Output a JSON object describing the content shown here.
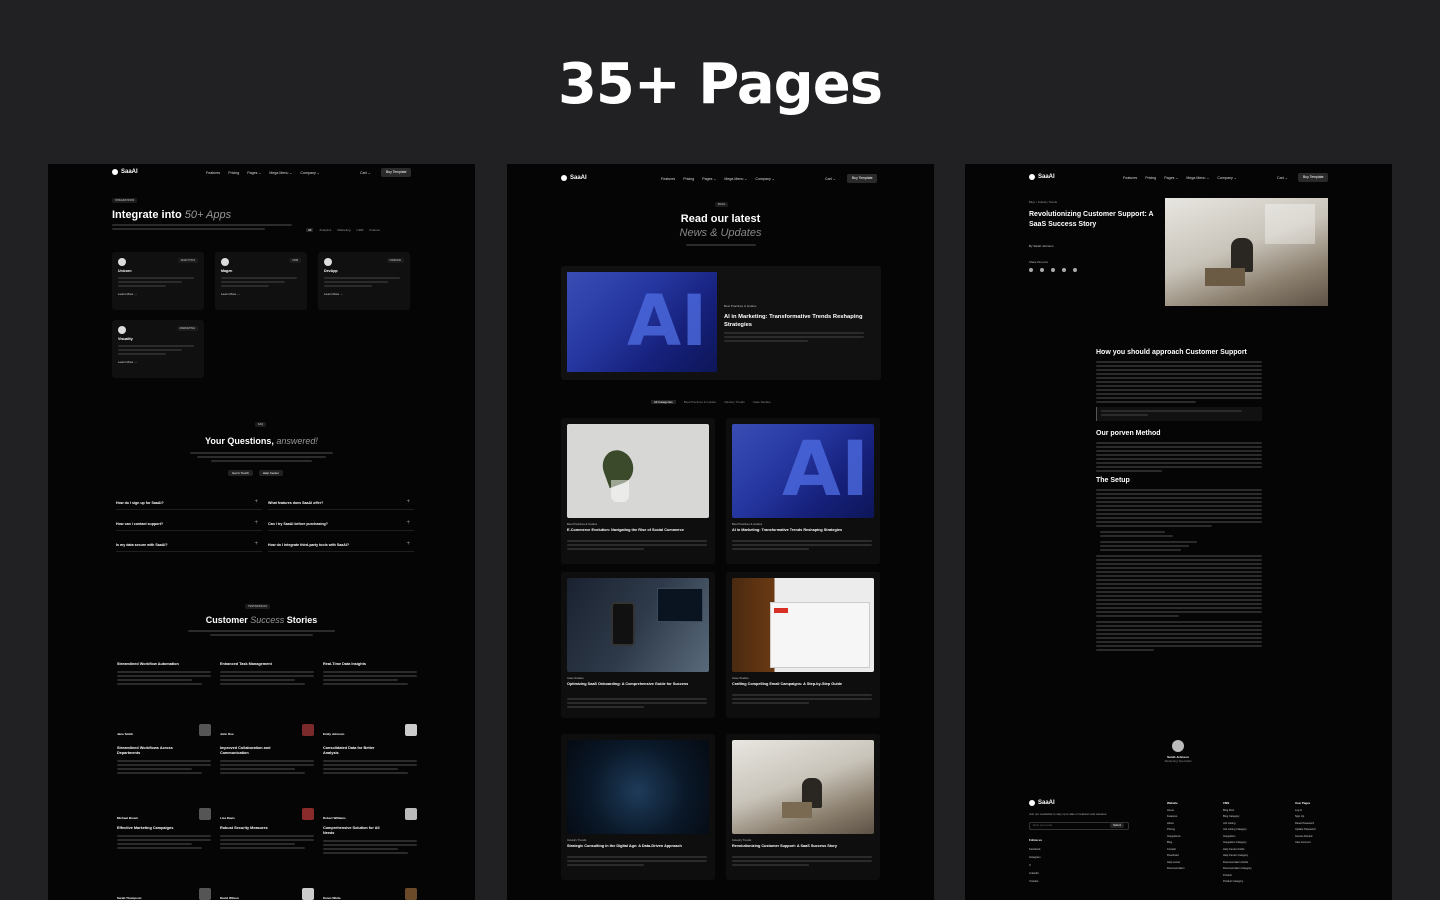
{
  "hero": {
    "title": "35+ Pages"
  },
  "nav": {
    "logo": "SaaAI",
    "links": [
      "Features",
      "Pricing",
      "Pages ⌄",
      "Mega Menu ⌄",
      "Company ⌄"
    ],
    "cart": "Cart ⌄",
    "buy": "Buy Template"
  },
  "integrations": {
    "tag": "INTEGRATIONS",
    "title_main": "Integrate into",
    "title_accent": "50+ Apps",
    "filters": [
      "All",
      "Analytics",
      "Marketing",
      "CRM",
      "Finance"
    ],
    "cards": [
      {
        "name": "Unicorn",
        "badge": "ANALYTICS",
        "link": "Learn More →"
      },
      {
        "name": "Magen",
        "badge": "CRM",
        "link": "Learn More →"
      },
      {
        "name": "DevApp",
        "badge": "FINANCE",
        "link": "Learn More →"
      },
      {
        "name": "Visuality",
        "badge": "MARKETING",
        "link": "Learn More →"
      }
    ]
  },
  "faq": {
    "tag": "FAQ",
    "title_main": "Your Questions,",
    "title_accent": "answered!",
    "buttons": [
      "Get in Touch",
      "Help Center"
    ],
    "questions": [
      "How do I sign up for SaaAI?",
      "How can I contact support?",
      "Is my data secure with SaaAI?",
      "What features does SaaAI offer?",
      "Can I try SaaAI before purchasing?",
      "How do I integrate third-party tools with SaaAI?"
    ]
  },
  "testimonials": {
    "tag": "TESTIMONIALS",
    "title_main": "Customer",
    "title_accent": "Success",
    "title_end": "Stories",
    "cards": [
      {
        "title": "Streamlined Workflow Automation",
        "name": "Jane Smith"
      },
      {
        "title": "Enhanced Task Management",
        "name": "John Doe"
      },
      {
        "title": "Real-Time Data Insights",
        "name": "Emily Johnson"
      },
      {
        "title": "Streamlined Workflows Across Departments",
        "name": "Michael Brown"
      },
      {
        "title": "Improved Collaboration and Communication",
        "name": "Lisa Davis"
      },
      {
        "title": "Consolidated Data for Better Analysis",
        "name": "Robert Williams"
      },
      {
        "title": "Effective Marketing Campaigns",
        "name": "Sarah Thompson"
      },
      {
        "title": "Robust Security Measures",
        "name": "David Wilson"
      },
      {
        "title": "Comprehensive Solution for All Needs",
        "name": "Karen White"
      }
    ]
  },
  "blog": {
    "tag": "BLOG",
    "title_line1": "Read our latest",
    "title_line2": "News & Updates",
    "featured": {
      "tag": "Best Practices & Guides",
      "title": "AI in Marketing: Transformative Trends Reshaping Strategies"
    },
    "categories": [
      "All Categories",
      "Best Practices & Guides",
      "Industry Trends",
      "Case Studies"
    ],
    "posts": [
      {
        "meta": "Best Practices & Guides",
        "title": "E-Commerce Evolution: Navigating the Rise of Social Commerce"
      },
      {
        "meta": "Best Practices & Guides",
        "title": "AI in Marketing: Transformative Trends Reshaping Strategies"
      },
      {
        "meta": "Case Studies",
        "title": "Optimizing SaaS Onboarding: A Comprehensive Guide for Success"
      },
      {
        "meta": "Case Studies",
        "title": "Crafting Compelling Email Campaigns: A Step-by-Step Guide"
      },
      {
        "meta": "Industry Trends",
        "title": "Strategic Consulting in the Digital Age: A Data-Driven Approach"
      },
      {
        "meta": "Industry Trends",
        "title": "Revolutionizing Customer Support: A SaaS Success Story"
      }
    ]
  },
  "article": {
    "crumb": "Blog > Industry Trends",
    "title": "Revolutionizing Customer Support: A SaaS Success Story",
    "author": "By Sarah Johnson",
    "share_label": "Share this post",
    "h1": "How you should approach Customer Support",
    "h2": "Our porven Method",
    "h3": "The Setup",
    "author_name": "Sarah Johnson",
    "author_role": "Marketing Specialist"
  },
  "footer": {
    "logo": "SaaAI",
    "desc": "Join our newsletter to stay up to date on features and releases.",
    "input_placeholder": "Enter your email",
    "submit": "Submit",
    "follow_label": "Follow us",
    "follow": [
      "Facebook",
      "Instagram",
      "X",
      "LinkedIn",
      "Youtube"
    ],
    "columns": [
      {
        "title": "Website",
        "items": [
          "Home",
          "Features",
          "About",
          "Pricing",
          "Integrations",
          "Blog",
          "Contact",
          "Download",
          "Help center",
          "Documentation"
        ]
      },
      {
        "title": "CMS",
        "items": [
          "Blog Post",
          "Blog Category",
          "Job Listing",
          "Job Listing Category",
          "Integration",
          "Integration Category",
          "Help Center Article",
          "Help Center Category",
          "Documentation Article",
          "Documentation Category",
          "Product",
          "Product Category"
        ]
      },
      {
        "title": "User Pages",
        "items": [
          "Log In",
          "Sign Up",
          "Reset Password",
          "Update Password",
          "Access Denied",
          "User Account"
        ]
      }
    ]
  }
}
